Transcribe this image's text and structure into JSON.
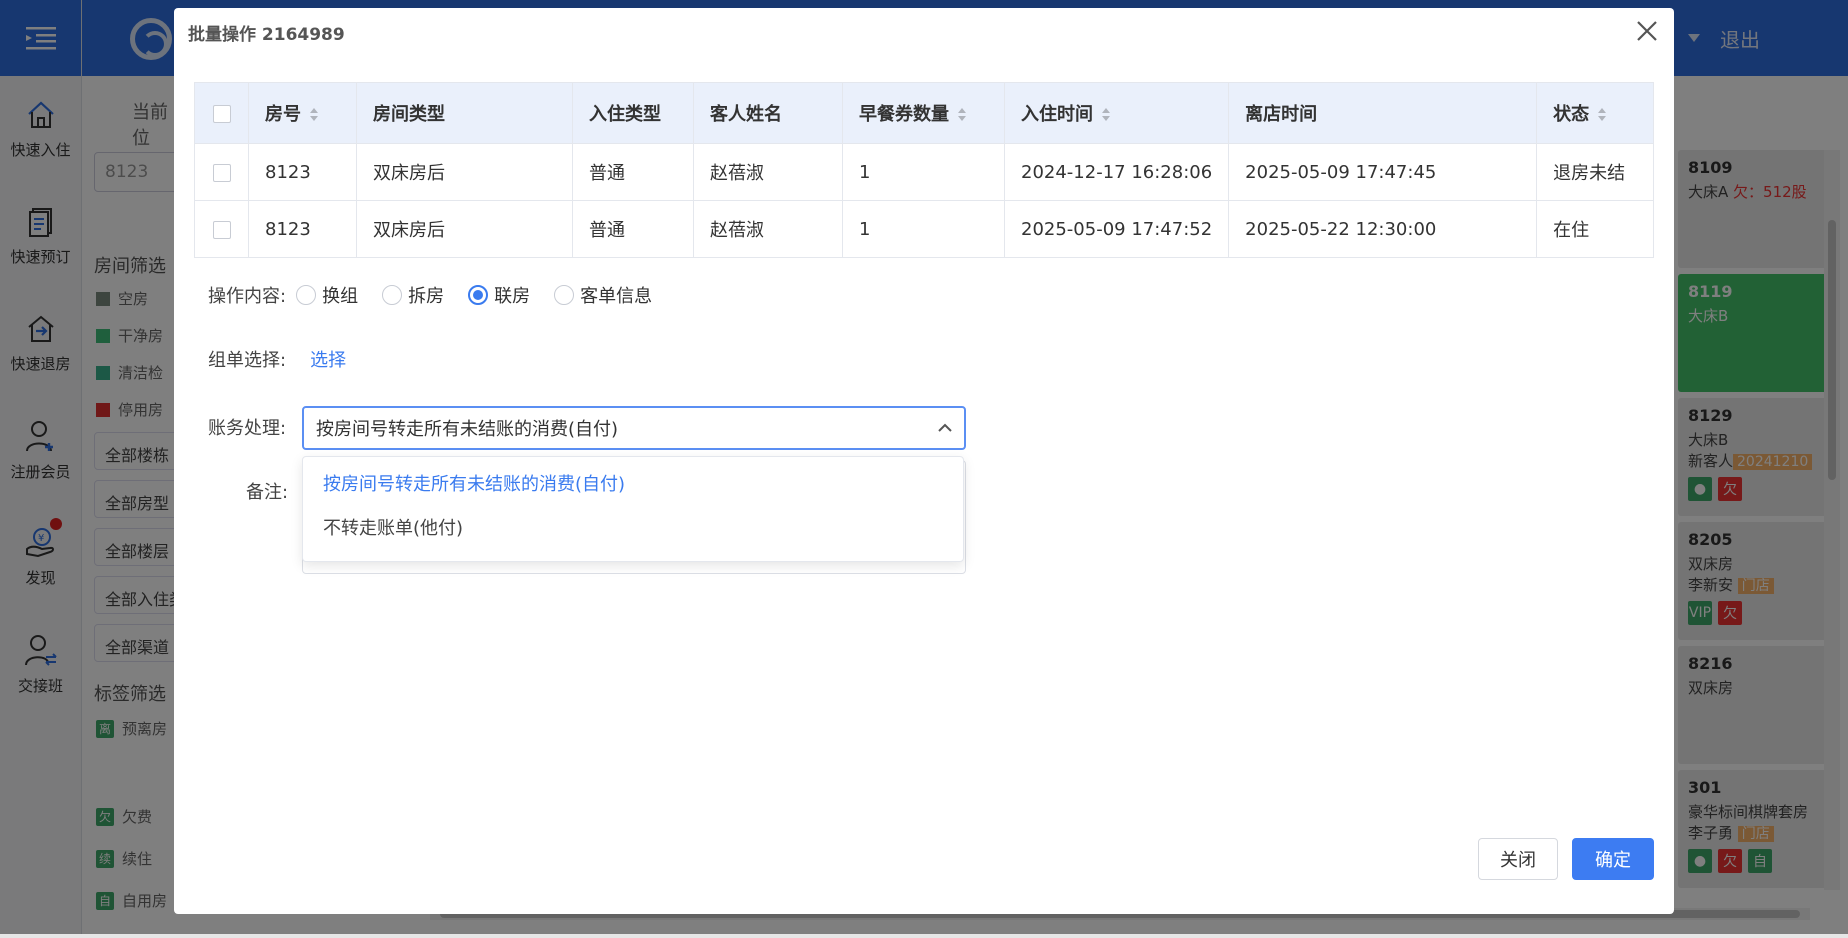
{
  "nav": {
    "items": [
      {
        "label": "快速入住",
        "icon": "home-checkin-icon"
      },
      {
        "label": "快速预订",
        "icon": "booking-list-icon"
      },
      {
        "label": "快速退房",
        "icon": "checkout-house-icon"
      },
      {
        "label": "注册会员",
        "icon": "add-member-icon"
      },
      {
        "label": "发现",
        "icon": "discover-money-hand-icon"
      },
      {
        "label": "交接班",
        "icon": "shift-handover-icon"
      }
    ]
  },
  "header": {
    "logout": "退出"
  },
  "page": {
    "breadcrumb": "当前位",
    "search_value": "8123",
    "room_filter_title": "房间筛选",
    "room_filters": [
      "空房",
      "干净房",
      "清洁检",
      "停用房"
    ],
    "dropdown_filters": [
      "全部楼栋",
      "全部房型",
      "全部楼层",
      "全部入住类",
      "全部渠道"
    ],
    "tag_filter_title": "标签筛选",
    "tag_filters": [
      {
        "tag": "离",
        "label": "预离房"
      },
      {
        "tag": "欠",
        "label": "欠费"
      },
      {
        "tag": "续",
        "label": "续住"
      },
      {
        "tag": "自",
        "label": "自用房"
      }
    ],
    "rooms": [
      {
        "num": "8109",
        "type": "大床A",
        "extra": "欠：512股"
      },
      {
        "num": "8119",
        "type": "大床B",
        "extra": ""
      },
      {
        "num": "8129",
        "type": "大床B",
        "guest": "新客人",
        "badge": "20241210",
        "icons": [
          "user",
          "欠"
        ]
      },
      {
        "num": "8205",
        "type": "双床房",
        "guest": "李新安",
        "badge": "门店",
        "icons": [
          "VIP",
          "欠"
        ]
      },
      {
        "num": "8216",
        "type": "双床房"
      },
      {
        "num": "301",
        "type": "豪华标间棋牌套房",
        "guest": "李子勇",
        "badge": "门店",
        "icons": [
          "user",
          "欠",
          "自"
        ]
      }
    ]
  },
  "modal": {
    "title": "批量操作 2164989",
    "table": {
      "headers": [
        "房号",
        "房间类型",
        "入住类型",
        "客人姓名",
        "早餐券数量",
        "入住时间",
        "离店时间",
        "状态"
      ],
      "rows": [
        [
          "8123",
          "双床房后",
          "普通",
          "赵蓓淑",
          "1",
          "2024-12-17 16:28:06",
          "2025-05-09 17:47:45",
          "退房未结"
        ],
        [
          "8123",
          "双床房后",
          "普通",
          "赵蓓淑",
          "1",
          "2025-05-09 17:47:52",
          "2025-05-22 12:30:00",
          "在住"
        ]
      ]
    },
    "operation_label": "操作内容:",
    "operations": [
      "换组",
      "拆房",
      "联房",
      "客单信息"
    ],
    "operation_selected": "联房",
    "group_label": "组单选择:",
    "group_link": "选择",
    "billing_label": "账务处理:",
    "billing_value": "按房间号转走所有未结账的消费(自付)",
    "billing_options": [
      "按房间号转走所有未结账的消费(自付)",
      "不转走账单(他付)"
    ],
    "remark_label": "备注:",
    "close_button": "关闭",
    "confirm_button": "确定"
  },
  "colors": {
    "brand": "#2f6fe0",
    "primary": "#3d7cf2",
    "room_green": "#45c26a",
    "owe_red": "#e33333"
  }
}
